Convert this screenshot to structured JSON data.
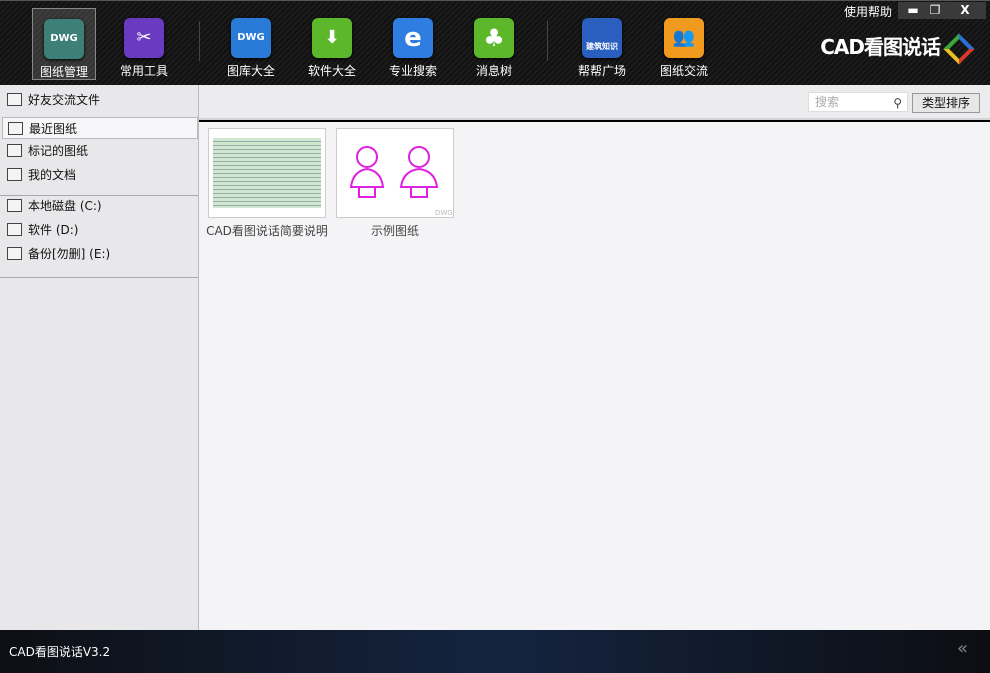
{
  "toolbar": {
    "items": [
      {
        "label": "图纸管理",
        "icon": "dwg-viewer-icon",
        "color": "#3d8078",
        "glyph": "DWG",
        "selected": true
      },
      {
        "label": "常用工具",
        "icon": "scissors-icon",
        "color": "#6a3bc0",
        "glyph": "✂"
      },
      {
        "label": "图库大全",
        "icon": "dwg-library-icon",
        "color": "#2a7ad8",
        "glyph": "DWG"
      },
      {
        "label": "软件大全",
        "icon": "download-box-icon",
        "color": "#5cb82a",
        "glyph": "⬇"
      },
      {
        "label": "专业搜索",
        "icon": "ie-search-icon",
        "color": "#2f7de0",
        "glyph": "e"
      },
      {
        "label": "消息树",
        "icon": "tree-icon",
        "color": "#5cb82a",
        "glyph": "♣"
      },
      {
        "label": "帮帮广场",
        "icon": "graduation-cap-icon",
        "color": "#2a5fc0",
        "glyph": "🎓",
        "caption": "建筑知识"
      },
      {
        "label": "图纸交流",
        "icon": "users-icon",
        "color": "#f09a20",
        "glyph": "👥"
      }
    ]
  },
  "window": {
    "help": "使用帮助",
    "minimize": "▬",
    "restore": "❐",
    "close": "X"
  },
  "logo": {
    "text": "CAD看图说话"
  },
  "sidebar": {
    "groups": [
      [
        {
          "label": "好友交流文件",
          "icon": "friend-icon"
        },
        {
          "label": "最近图纸",
          "icon": "recent-icon",
          "selected": true
        },
        {
          "label": "标记的图纸",
          "icon": "marked-folder-icon"
        },
        {
          "label": "我的文档",
          "icon": "documents-icon"
        }
      ],
      [
        {
          "label": "本地磁盘 (C:)",
          "icon": "monitor-icon"
        },
        {
          "label": "软件 (D:)",
          "icon": "monitor-icon"
        },
        {
          "label": "备份[勿删] (E:)",
          "icon": "monitor-icon"
        }
      ]
    ]
  },
  "main": {
    "search_placeholder": "搜索",
    "sort_label": "类型排序",
    "files": [
      {
        "name": "CAD看图说话简要说明"
      },
      {
        "name": "示例图纸",
        "badge": "DWG"
      }
    ]
  },
  "footer": {
    "version": "CAD看图说话V3.2",
    "collapse": "«"
  }
}
